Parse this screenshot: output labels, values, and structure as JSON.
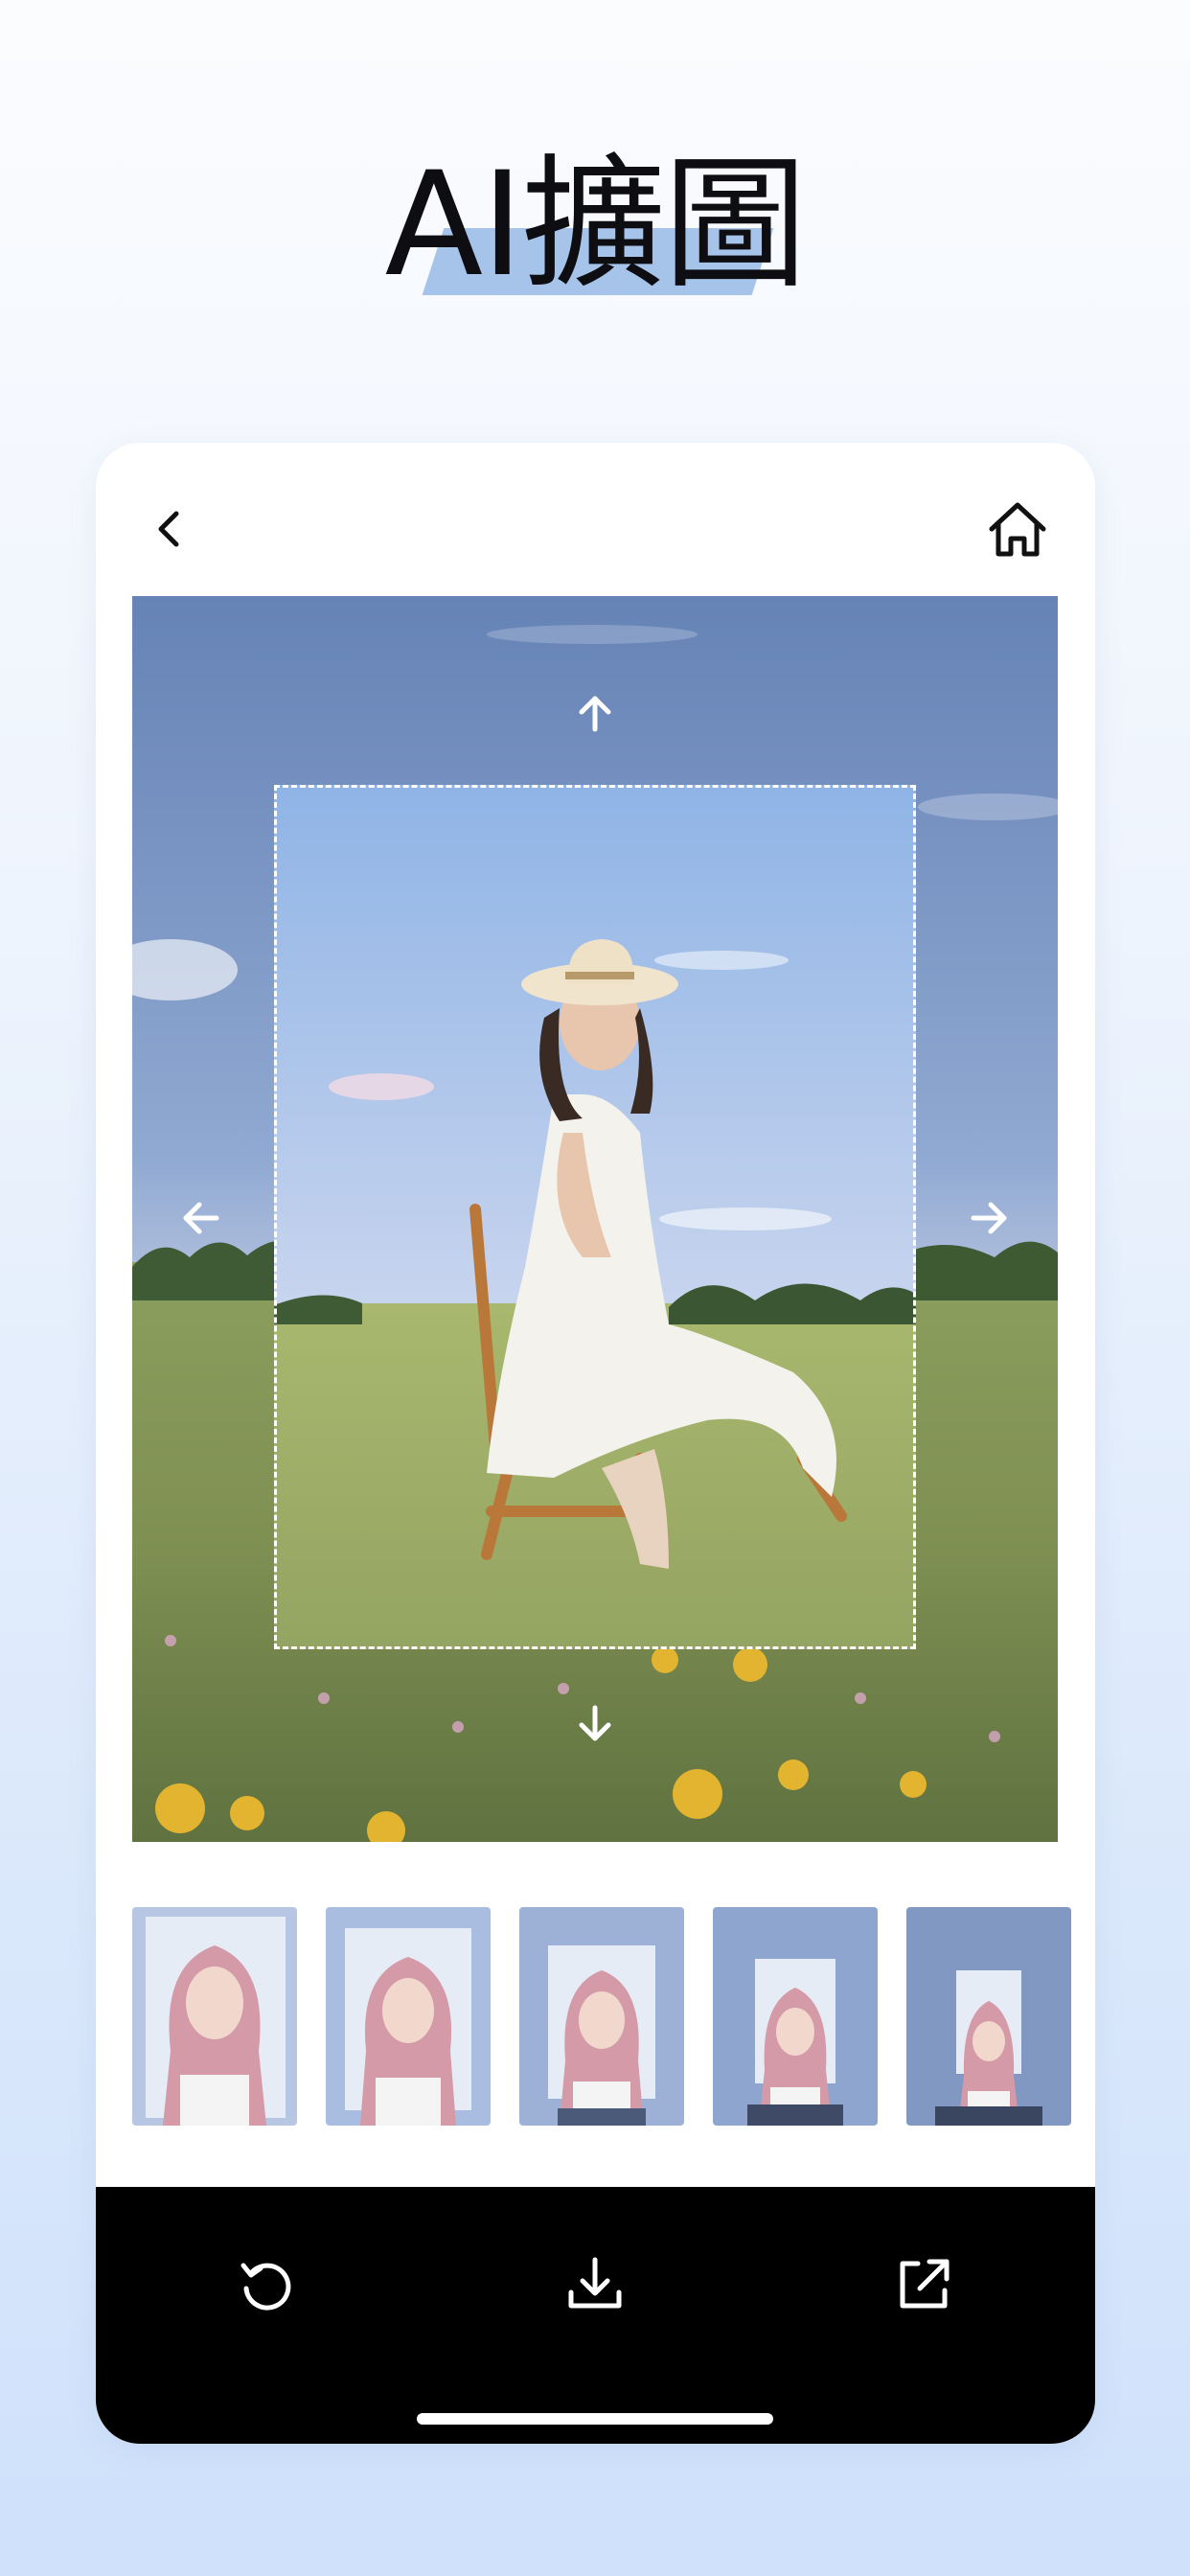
{
  "headline": {
    "text": "AI擴圖"
  },
  "colors": {
    "accent_bar": "#a6c3ea",
    "toolbar_bg": "#000000"
  },
  "topbar": {
    "back_icon": "chevron-left-icon",
    "home_icon": "home-icon"
  },
  "editor": {
    "expand_controls": [
      "arrow-up-icon",
      "arrow-left-icon",
      "arrow-right-icon",
      "arrow-down-icon"
    ]
  },
  "thumbnails": {
    "count": 5
  },
  "toolbar": {
    "icons": [
      "undo-icon",
      "download-icon",
      "share-icon"
    ]
  }
}
